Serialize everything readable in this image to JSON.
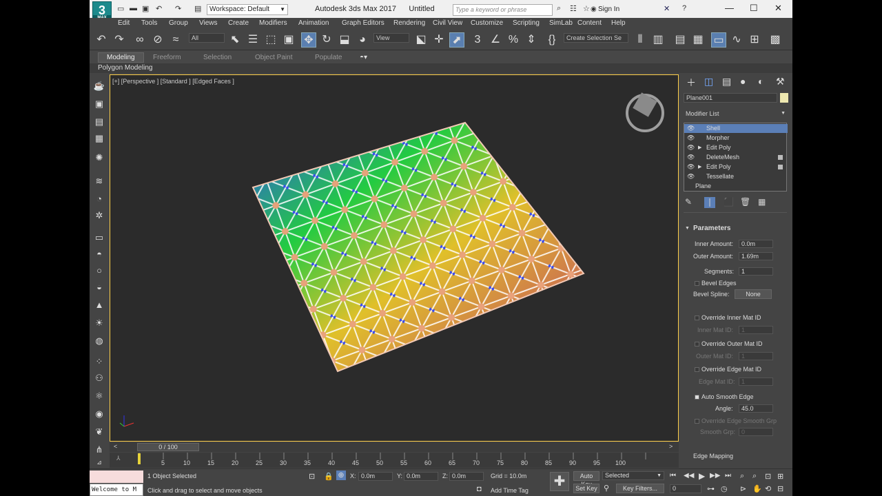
{
  "app": {
    "logo_text": "3",
    "logo_sub": "MAX",
    "title": "Autodesk 3ds Max 2017",
    "doc": "Untitled",
    "workspace": "Workspace: Default",
    "search_placeholder": "Type a keyword or phrase",
    "sign_in": "Sign In"
  },
  "menu": [
    "Edit",
    "Tools",
    "Group",
    "Views",
    "Create",
    "Modifiers",
    "Animation",
    "Graph Editors",
    "Rendering",
    "Civil View",
    "Customize",
    "Scripting",
    "SimLab",
    "Content",
    "Help"
  ],
  "toolbar": {
    "filter": "All",
    "refcoord": "View",
    "selection_set": "Create Selection Se"
  },
  "ribbon": {
    "tabs": [
      "Modeling",
      "Freeform",
      "Selection",
      "Object Paint",
      "Populate"
    ],
    "sub": "Polygon Modeling"
  },
  "viewport": {
    "label": "[+] [Perspective ] [Standard ] [Edged Faces ]"
  },
  "timeline": {
    "frame": "0 / 100",
    "ticks": [
      "5",
      "10",
      "15",
      "20",
      "25",
      "30",
      "35",
      "40",
      "45",
      "50",
      "55",
      "60",
      "65",
      "70",
      "75",
      "80",
      "85",
      "90",
      "95",
      "100"
    ]
  },
  "command_panel": {
    "object_name": "Plane001",
    "modifier_list": "Modifier List",
    "stack": [
      {
        "label": "Shell",
        "selected": true
      },
      {
        "label": "Morpher",
        "selected": false
      },
      {
        "label": "Edit Poly",
        "selected": false
      },
      {
        "label": "DeleteMesh",
        "selected": false
      },
      {
        "label": "Edit Poly",
        "selected": false
      },
      {
        "label": "Tessellate",
        "selected": false
      },
      {
        "label": "Plane",
        "selected": false
      }
    ],
    "params": {
      "header": "Parameters",
      "inner_amount_label": "Inner Amount:",
      "inner_amount": "0.0m",
      "outer_amount_label": "Outer Amount:",
      "outer_amount": "1.69m",
      "segments_label": "Segments:",
      "segments": "1",
      "bevel_edges": "Bevel Edges",
      "bevel_spline_label": "Bevel Spline:",
      "bevel_spline": "None",
      "override_inner": "Override Inner Mat ID",
      "inner_mat_label": "Inner Mat ID:",
      "inner_mat": "1",
      "override_outer": "Override Outer Mat ID",
      "outer_mat_label": "Outer Mat ID:",
      "outer_mat": "1",
      "override_edge": "Override Edge Mat ID",
      "edge_mat_label": "Edge Mat ID:",
      "edge_mat": "1",
      "auto_smooth": "Auto Smooth Edge",
      "angle_label": "Angle:",
      "angle": "45.0",
      "override_smooth": "Override Edge Smooth Grp",
      "smooth_grp_label": "Smooth Grp:",
      "smooth_grp": "0",
      "edge_mapping": "Edge Mapping"
    }
  },
  "status": {
    "maxscript": "Welcome to M",
    "selected": "1 Object Selected",
    "hint": "Click and drag to select and move objects",
    "x_label": "X:",
    "x": "0.0m",
    "y_label": "Y:",
    "y": "0.0m",
    "z_label": "Z:",
    "z": "0.0m",
    "grid": "Grid = 10.0m",
    "add_time_tag": "Add Time Tag",
    "auto_key": "Auto Key",
    "selected_dd": "Selected",
    "set_key": "Set Key",
    "key_filters": "Key Filters...",
    "frame": "0"
  },
  "colors": {
    "accent": "#5b7fb7",
    "viewport_border": "#ffd04a",
    "logo": "#1d8a8c"
  }
}
